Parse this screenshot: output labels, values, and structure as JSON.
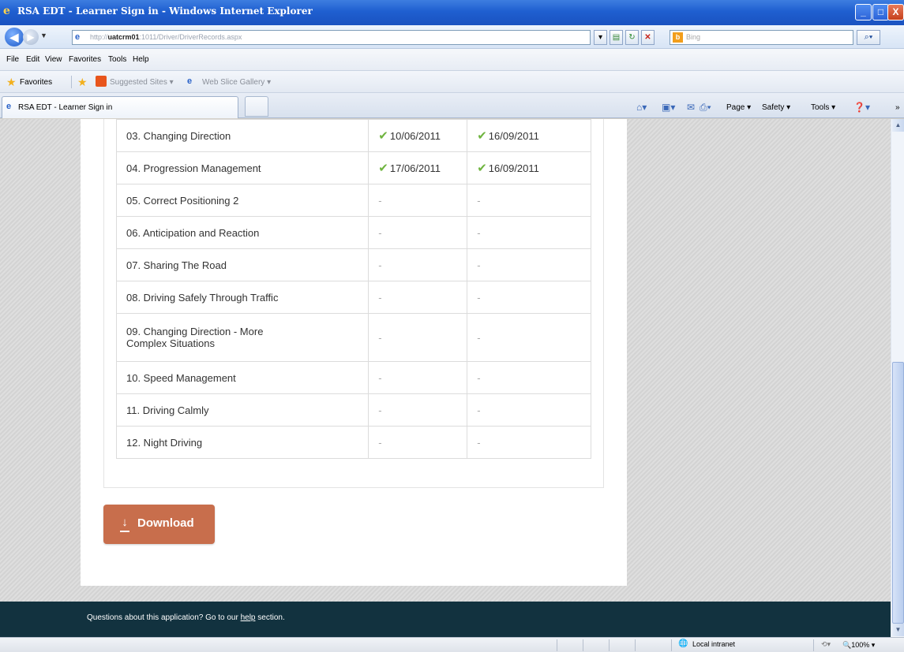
{
  "window": {
    "title": "RSA EDT - Learner Sign in - Windows Internet Explorer",
    "min_label": "_",
    "max_label": "□",
    "close_label": "X"
  },
  "address_bar": {
    "url_prefix": "http://",
    "url_host": "uatcrm01",
    "url_rest": ":1011/Driver/DriverRecords.aspx",
    "search_placeholder": "Bing"
  },
  "menu": [
    "File",
    "Edit",
    "View",
    "Favorites",
    "Tools",
    "Help"
  ],
  "favorites_bar": {
    "favorites_label": "Favorites",
    "suggested_sites": "Suggested Sites ▾",
    "web_slice_gallery": "Web Slice Gallery ▾"
  },
  "tab": {
    "label": "RSA EDT - Learner Sign in"
  },
  "command_bar": {
    "page": "Page ▾",
    "safety": "Safety ▾",
    "tools": "Tools ▾"
  },
  "records": [
    {
      "name": "03. Changing Direction",
      "date1": "10/06/2011",
      "date2": "16/09/2011",
      "done": true
    },
    {
      "name": "04. Progression Management",
      "date1": "17/06/2011",
      "date2": "16/09/2011",
      "done": true
    },
    {
      "name": "05. Correct Positioning 2",
      "date1": "-",
      "date2": "-",
      "done": false
    },
    {
      "name": "06. Anticipation and Reaction",
      "date1": "-",
      "date2": "-",
      "done": false
    },
    {
      "name": "07. Sharing The Road",
      "date1": "-",
      "date2": "-",
      "done": false
    },
    {
      "name": "08. Driving Safely Through Traffic",
      "date1": "-",
      "date2": "-",
      "done": false
    },
    {
      "name": "09. Changing Direction - More Complex Situations",
      "date1": "-",
      "date2": "-",
      "done": false
    },
    {
      "name": "10. Speed Management",
      "date1": "-",
      "date2": "-",
      "done": false
    },
    {
      "name": "11. Driving Calmly",
      "date1": "-",
      "date2": "-",
      "done": false
    },
    {
      "name": "12. Night Driving",
      "date1": "-",
      "date2": "-",
      "done": false
    }
  ],
  "download_button": {
    "label": "Download"
  },
  "footer": {
    "text_before": "Questions about this application? Go to our ",
    "link": "help",
    "text_after": " section."
  },
  "status_bar": {
    "zone": "Local intranet",
    "zoom": "100%"
  },
  "colors": {
    "download_button": "#c86e4c",
    "footer_bg": "#12323f",
    "tick": "#6fb43f"
  }
}
